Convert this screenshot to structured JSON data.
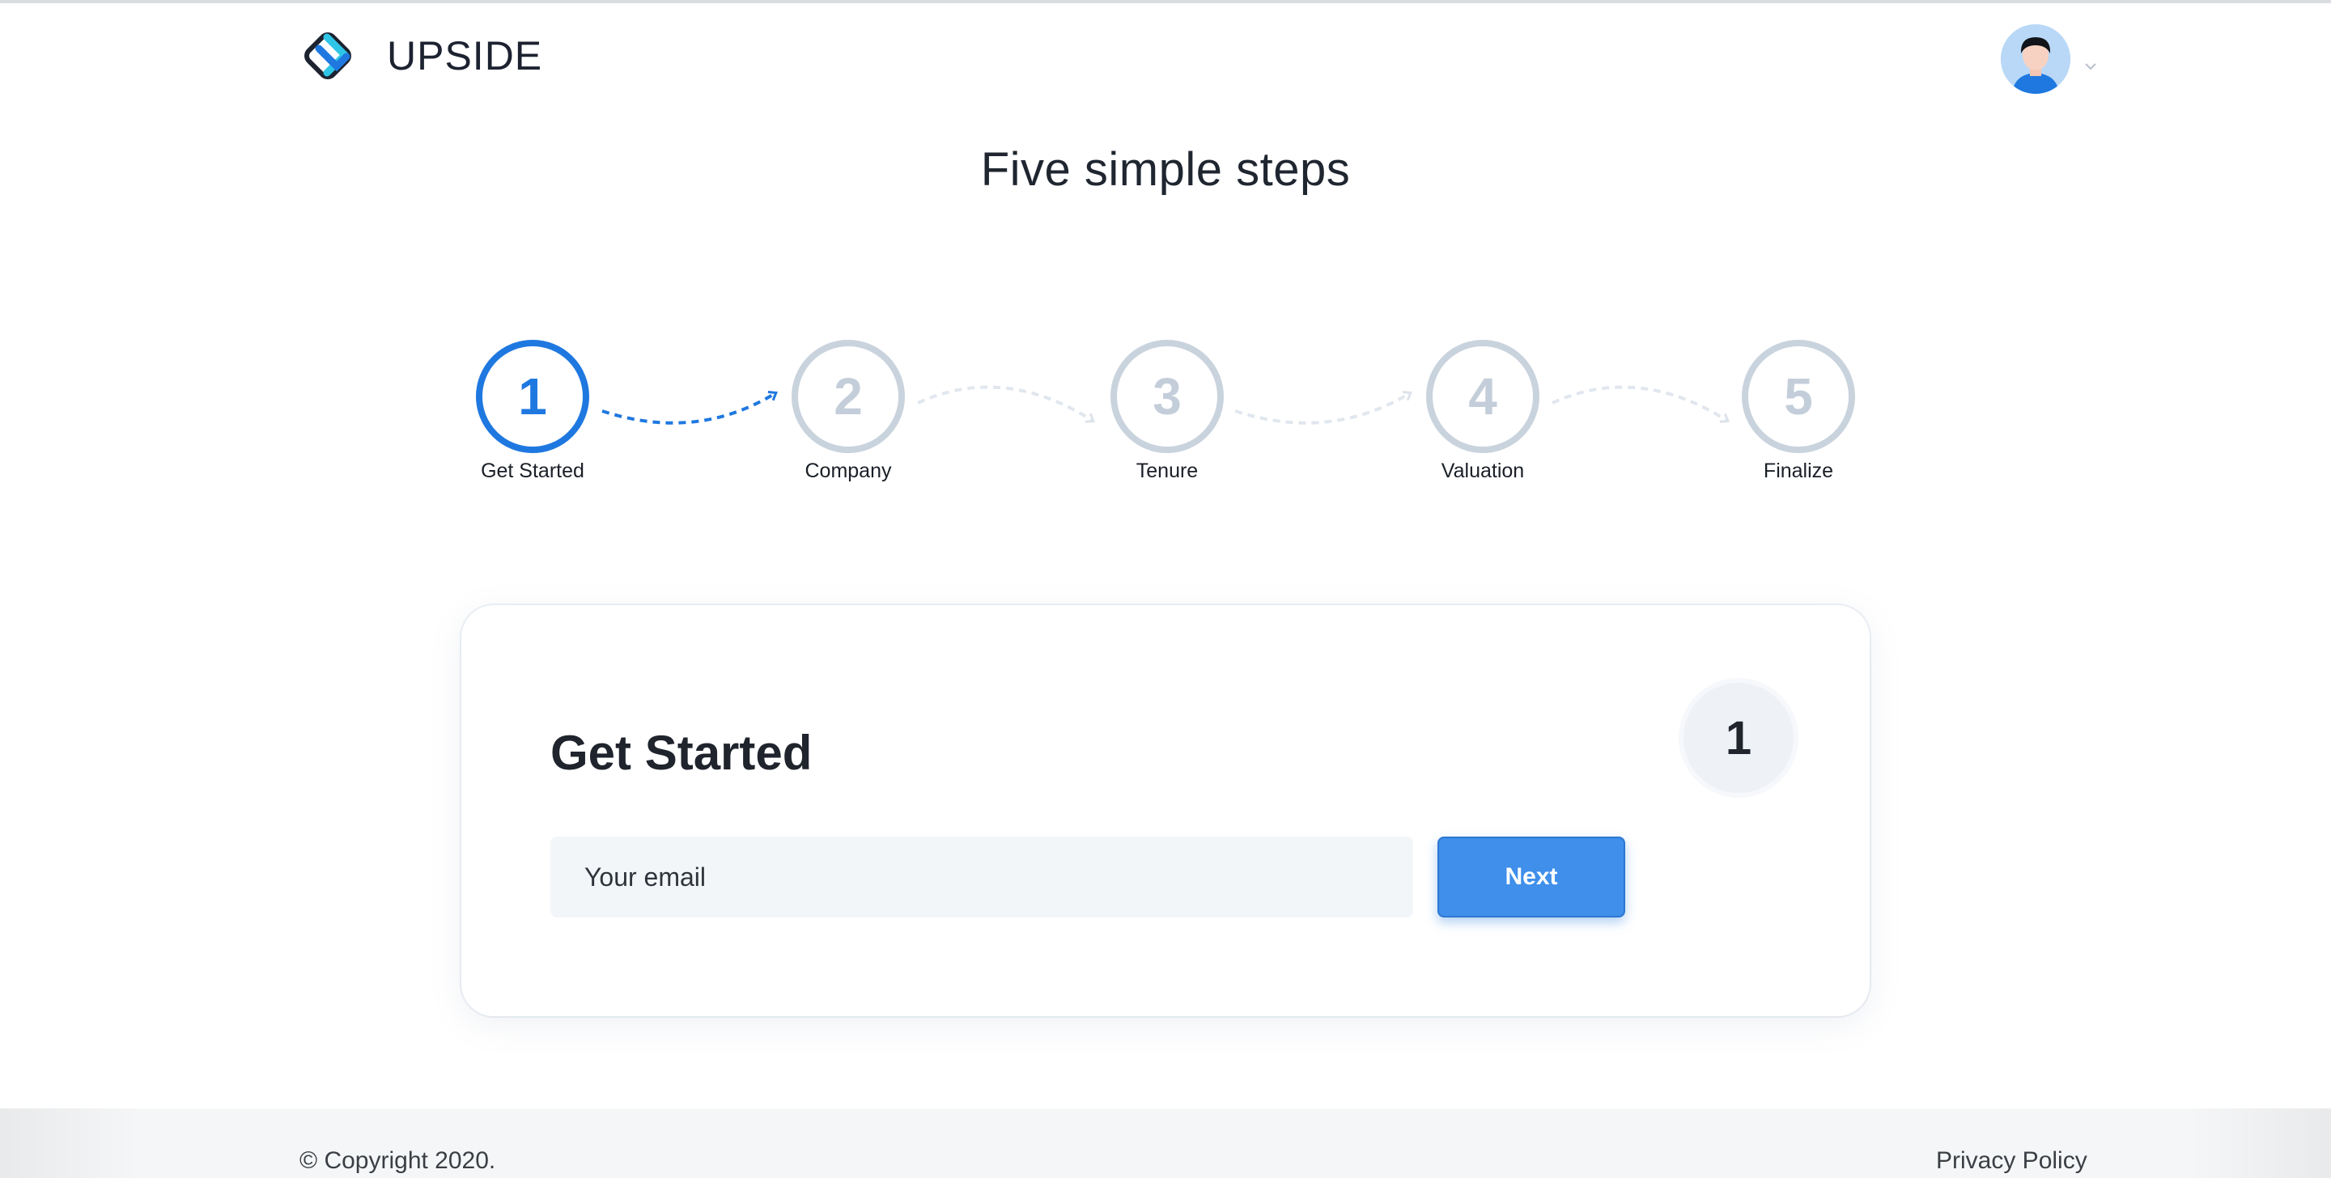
{
  "brand": {
    "name": "UPSIDE",
    "accent": "#1f78e0",
    "secondary": "#2ec5e6"
  },
  "header": {
    "avatar_icon": "user-avatar-icon",
    "menu_icon": "chevron-down-icon"
  },
  "page_title": "Five simple steps",
  "steps": [
    {
      "number": "1",
      "label": "Get Started",
      "state": "active"
    },
    {
      "number": "2",
      "label": "Company",
      "state": "inactive"
    },
    {
      "number": "3",
      "label": "Tenure",
      "state": "inactive"
    },
    {
      "number": "4",
      "label": "Valuation",
      "state": "inactive"
    },
    {
      "number": "5",
      "label": "Finalize",
      "state": "inactive"
    }
  ],
  "card": {
    "title": "Get Started",
    "badge": "1",
    "email_placeholder": "Your email",
    "email_value": "",
    "next_label": "Next"
  },
  "footer": {
    "copyright": "© Copyright 2020.",
    "privacy": "Privacy Policy"
  }
}
